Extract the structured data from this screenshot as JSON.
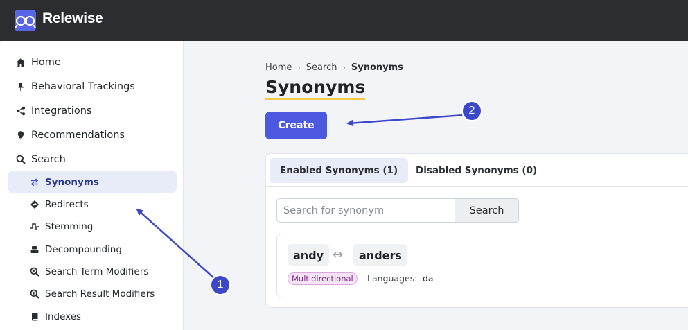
{
  "app": {
    "name": "Relewise"
  },
  "sidebar": {
    "items": [
      {
        "label": "Home",
        "icon": "home-icon"
      },
      {
        "label": "Behavioral Trackings",
        "icon": "pin-icon"
      },
      {
        "label": "Integrations",
        "icon": "share-icon"
      },
      {
        "label": "Recommendations",
        "icon": "lightbulb-icon"
      },
      {
        "label": "Search",
        "icon": "search-icon"
      }
    ],
    "subitems": [
      {
        "label": "Synonyms",
        "icon": "swap-arrows-icon",
        "active": true
      },
      {
        "label": "Redirects",
        "icon": "diamond-arrow-icon"
      },
      {
        "label": "Stemming",
        "icon": "waveform-icon"
      },
      {
        "label": "Decompounding",
        "icon": "split-icon"
      },
      {
        "label": "Search Term Modifiers",
        "icon": "search-plus-icon"
      },
      {
        "label": "Search Result Modifiers",
        "icon": "search-plus-icon"
      },
      {
        "label": "Indexes",
        "icon": "book-icon"
      }
    ]
  },
  "breadcrumb": {
    "items": [
      "Home",
      "Search",
      "Synonyms"
    ]
  },
  "page": {
    "title": "Synonyms",
    "create_label": "Create"
  },
  "tabs": [
    {
      "label": "Enabled Synonyms (1)",
      "active": true
    },
    {
      "label": "Disabled Synonyms (0)",
      "active": false
    }
  ],
  "search": {
    "placeholder": "Search for synonym",
    "button_label": "Search"
  },
  "synonym": {
    "words": [
      "andy",
      "anders"
    ],
    "separator": "↔",
    "type_badge": "Multidirectional",
    "languages_label": "Languages:",
    "languages_value": "da"
  },
  "annotations": {
    "step1": "1",
    "step2": "2"
  },
  "colors": {
    "accent": "#4c58e0",
    "topbar": "#2b2d31",
    "annotation": "#3d47c9",
    "badge_bg": "#f6e3f7"
  }
}
